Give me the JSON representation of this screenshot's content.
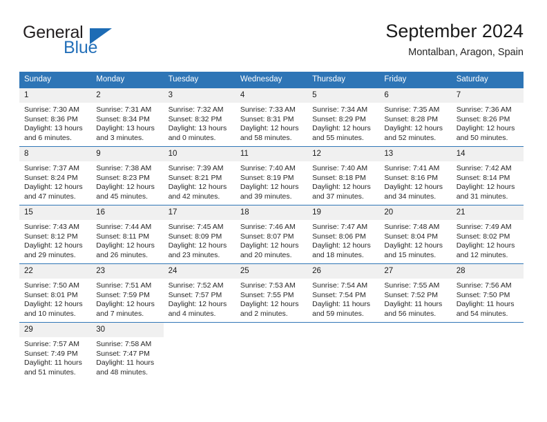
{
  "brand": {
    "name_part1": "General",
    "name_part2": "Blue",
    "accent_color": "#2470b9"
  },
  "header": {
    "month_title": "September 2024",
    "location": "Montalban, Aragon, Spain",
    "header_bg_color": "#2e75b6",
    "daynum_bg_color": "#f0f0f0"
  },
  "weekday_headers": [
    "Sunday",
    "Monday",
    "Tuesday",
    "Wednesday",
    "Thursday",
    "Friday",
    "Saturday"
  ],
  "weeks": [
    [
      {
        "day": "1",
        "sunrise": "Sunrise: 7:30 AM",
        "sunset": "Sunset: 8:36 PM",
        "daylight1": "Daylight: 13 hours",
        "daylight2": "and 6 minutes."
      },
      {
        "day": "2",
        "sunrise": "Sunrise: 7:31 AM",
        "sunset": "Sunset: 8:34 PM",
        "daylight1": "Daylight: 13 hours",
        "daylight2": "and 3 minutes."
      },
      {
        "day": "3",
        "sunrise": "Sunrise: 7:32 AM",
        "sunset": "Sunset: 8:32 PM",
        "daylight1": "Daylight: 13 hours",
        "daylight2": "and 0 minutes."
      },
      {
        "day": "4",
        "sunrise": "Sunrise: 7:33 AM",
        "sunset": "Sunset: 8:31 PM",
        "daylight1": "Daylight: 12 hours",
        "daylight2": "and 58 minutes."
      },
      {
        "day": "5",
        "sunrise": "Sunrise: 7:34 AM",
        "sunset": "Sunset: 8:29 PM",
        "daylight1": "Daylight: 12 hours",
        "daylight2": "and 55 minutes."
      },
      {
        "day": "6",
        "sunrise": "Sunrise: 7:35 AM",
        "sunset": "Sunset: 8:28 PM",
        "daylight1": "Daylight: 12 hours",
        "daylight2": "and 52 minutes."
      },
      {
        "day": "7",
        "sunrise": "Sunrise: 7:36 AM",
        "sunset": "Sunset: 8:26 PM",
        "daylight1": "Daylight: 12 hours",
        "daylight2": "and 50 minutes."
      }
    ],
    [
      {
        "day": "8",
        "sunrise": "Sunrise: 7:37 AM",
        "sunset": "Sunset: 8:24 PM",
        "daylight1": "Daylight: 12 hours",
        "daylight2": "and 47 minutes."
      },
      {
        "day": "9",
        "sunrise": "Sunrise: 7:38 AM",
        "sunset": "Sunset: 8:23 PM",
        "daylight1": "Daylight: 12 hours",
        "daylight2": "and 45 minutes."
      },
      {
        "day": "10",
        "sunrise": "Sunrise: 7:39 AM",
        "sunset": "Sunset: 8:21 PM",
        "daylight1": "Daylight: 12 hours",
        "daylight2": "and 42 minutes."
      },
      {
        "day": "11",
        "sunrise": "Sunrise: 7:40 AM",
        "sunset": "Sunset: 8:19 PM",
        "daylight1": "Daylight: 12 hours",
        "daylight2": "and 39 minutes."
      },
      {
        "day": "12",
        "sunrise": "Sunrise: 7:40 AM",
        "sunset": "Sunset: 8:18 PM",
        "daylight1": "Daylight: 12 hours",
        "daylight2": "and 37 minutes."
      },
      {
        "day": "13",
        "sunrise": "Sunrise: 7:41 AM",
        "sunset": "Sunset: 8:16 PM",
        "daylight1": "Daylight: 12 hours",
        "daylight2": "and 34 minutes."
      },
      {
        "day": "14",
        "sunrise": "Sunrise: 7:42 AM",
        "sunset": "Sunset: 8:14 PM",
        "daylight1": "Daylight: 12 hours",
        "daylight2": "and 31 minutes."
      }
    ],
    [
      {
        "day": "15",
        "sunrise": "Sunrise: 7:43 AM",
        "sunset": "Sunset: 8:12 PM",
        "daylight1": "Daylight: 12 hours",
        "daylight2": "and 29 minutes."
      },
      {
        "day": "16",
        "sunrise": "Sunrise: 7:44 AM",
        "sunset": "Sunset: 8:11 PM",
        "daylight1": "Daylight: 12 hours",
        "daylight2": "and 26 minutes."
      },
      {
        "day": "17",
        "sunrise": "Sunrise: 7:45 AM",
        "sunset": "Sunset: 8:09 PM",
        "daylight1": "Daylight: 12 hours",
        "daylight2": "and 23 minutes."
      },
      {
        "day": "18",
        "sunrise": "Sunrise: 7:46 AM",
        "sunset": "Sunset: 8:07 PM",
        "daylight1": "Daylight: 12 hours",
        "daylight2": "and 20 minutes."
      },
      {
        "day": "19",
        "sunrise": "Sunrise: 7:47 AM",
        "sunset": "Sunset: 8:06 PM",
        "daylight1": "Daylight: 12 hours",
        "daylight2": "and 18 minutes."
      },
      {
        "day": "20",
        "sunrise": "Sunrise: 7:48 AM",
        "sunset": "Sunset: 8:04 PM",
        "daylight1": "Daylight: 12 hours",
        "daylight2": "and 15 minutes."
      },
      {
        "day": "21",
        "sunrise": "Sunrise: 7:49 AM",
        "sunset": "Sunset: 8:02 PM",
        "daylight1": "Daylight: 12 hours",
        "daylight2": "and 12 minutes."
      }
    ],
    [
      {
        "day": "22",
        "sunrise": "Sunrise: 7:50 AM",
        "sunset": "Sunset: 8:01 PM",
        "daylight1": "Daylight: 12 hours",
        "daylight2": "and 10 minutes."
      },
      {
        "day": "23",
        "sunrise": "Sunrise: 7:51 AM",
        "sunset": "Sunset: 7:59 PM",
        "daylight1": "Daylight: 12 hours",
        "daylight2": "and 7 minutes."
      },
      {
        "day": "24",
        "sunrise": "Sunrise: 7:52 AM",
        "sunset": "Sunset: 7:57 PM",
        "daylight1": "Daylight: 12 hours",
        "daylight2": "and 4 minutes."
      },
      {
        "day": "25",
        "sunrise": "Sunrise: 7:53 AM",
        "sunset": "Sunset: 7:55 PM",
        "daylight1": "Daylight: 12 hours",
        "daylight2": "and 2 minutes."
      },
      {
        "day": "26",
        "sunrise": "Sunrise: 7:54 AM",
        "sunset": "Sunset: 7:54 PM",
        "daylight1": "Daylight: 11 hours",
        "daylight2": "and 59 minutes."
      },
      {
        "day": "27",
        "sunrise": "Sunrise: 7:55 AM",
        "sunset": "Sunset: 7:52 PM",
        "daylight1": "Daylight: 11 hours",
        "daylight2": "and 56 minutes."
      },
      {
        "day": "28",
        "sunrise": "Sunrise: 7:56 AM",
        "sunset": "Sunset: 7:50 PM",
        "daylight1": "Daylight: 11 hours",
        "daylight2": "and 54 minutes."
      }
    ],
    [
      {
        "day": "29",
        "sunrise": "Sunrise: 7:57 AM",
        "sunset": "Sunset: 7:49 PM",
        "daylight1": "Daylight: 11 hours",
        "daylight2": "and 51 minutes."
      },
      {
        "day": "30",
        "sunrise": "Sunrise: 7:58 AM",
        "sunset": "Sunset: 7:47 PM",
        "daylight1": "Daylight: 11 hours",
        "daylight2": "and 48 minutes."
      },
      {
        "day": "",
        "sunrise": "",
        "sunset": "",
        "daylight1": "",
        "daylight2": ""
      },
      {
        "day": "",
        "sunrise": "",
        "sunset": "",
        "daylight1": "",
        "daylight2": ""
      },
      {
        "day": "",
        "sunrise": "",
        "sunset": "",
        "daylight1": "",
        "daylight2": ""
      },
      {
        "day": "",
        "sunrise": "",
        "sunset": "",
        "daylight1": "",
        "daylight2": ""
      },
      {
        "day": "",
        "sunrise": "",
        "sunset": "",
        "daylight1": "",
        "daylight2": ""
      }
    ]
  ]
}
